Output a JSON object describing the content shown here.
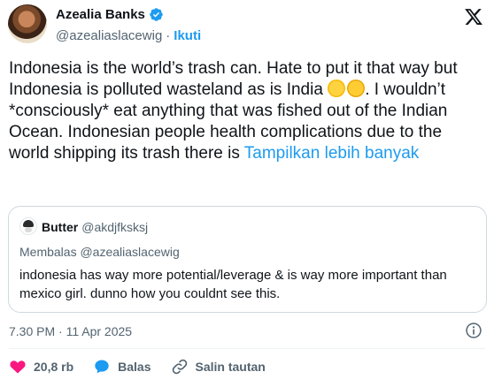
{
  "author": {
    "name": "Azealia Banks",
    "handle": "@azealiaslacewig",
    "follow_sep": "·",
    "follow_label": "Ikuti"
  },
  "tweet": {
    "text": "Indonesia is the world’s trash can. Hate to put it that way but Indonesia is polluted wasteland as is India ",
    "text_after_emoji": ". I wouldn’t *consciously* eat anything that was fished out of the Indian Ocean. Indonesian people health complications due to the world shipping its trash there is ",
    "show_more": "Tampilkan lebih banyak"
  },
  "quote": {
    "name": "Butter",
    "handle": "@akdjfksksj",
    "reply_to": "Membalas @azealiaslacewig",
    "text": "indonesia has way more potential/leverage & is way more important than mexico girl. dunno how you couldnt see this."
  },
  "timestamp": "7.30 PM · 11 Apr 2025",
  "actions": {
    "like_count": "20,8 rb",
    "reply_label": "Balas",
    "copy_link_label": "Salin tautan"
  },
  "icons": {
    "verified": "verified-badge-icon",
    "x_logo": "x-logo-icon",
    "info": "info-icon",
    "like": "heart-icon",
    "reply": "speech-bubble-icon",
    "link": "link-icon"
  },
  "colors": {
    "accent": "#1d9bf0",
    "like": "#f91880",
    "secondary_text": "#536471",
    "border": "#cfd9de"
  }
}
